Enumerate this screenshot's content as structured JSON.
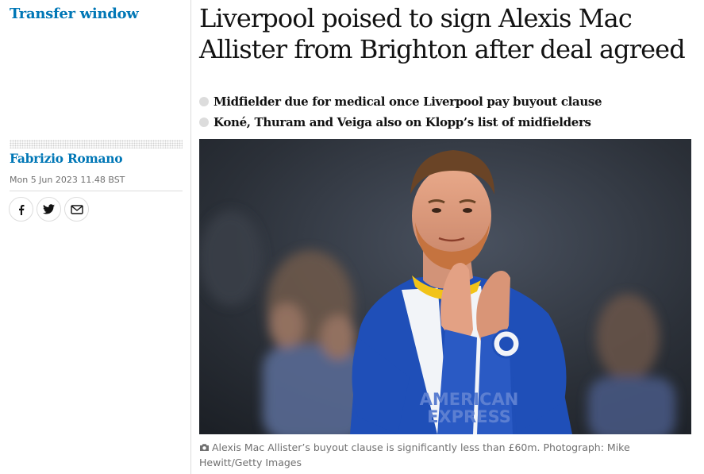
{
  "section": {
    "label": "Transfer window"
  },
  "byline": {
    "author": "Fabrizio Romano",
    "date": "Mon 5 Jun 2023 11.48 BST"
  },
  "share": [
    {
      "name": "facebook-icon"
    },
    {
      "name": "twitter-icon"
    },
    {
      "name": "email-icon"
    }
  ],
  "article": {
    "headline": "Liverpool poised to sign Alexis Mac Allister from Brighton after deal agreed",
    "standfirst": [
      "Midfielder due for medical once Liverpool pay buyout clause",
      "Koné, Thuram and Veiga also on Klopp’s list of midfielders"
    ],
    "image": {
      "shirt_text_line1": "AMERICAN",
      "shirt_text_line2": "EXPRESS",
      "colors": {
        "shirt_blue": "#1f4fb8",
        "shirt_white": "#f2f4f8",
        "trim_yellow": "#f2c318"
      }
    },
    "caption": "Alexis Mac Allister’s buyout clause is significantly less than £60m. Photograph: Mike Hewitt/Getty Images"
  },
  "colors": {
    "link_blue": "#0077b6",
    "text": "#121212",
    "muted": "#707070",
    "rule": "#dcdcdc"
  }
}
